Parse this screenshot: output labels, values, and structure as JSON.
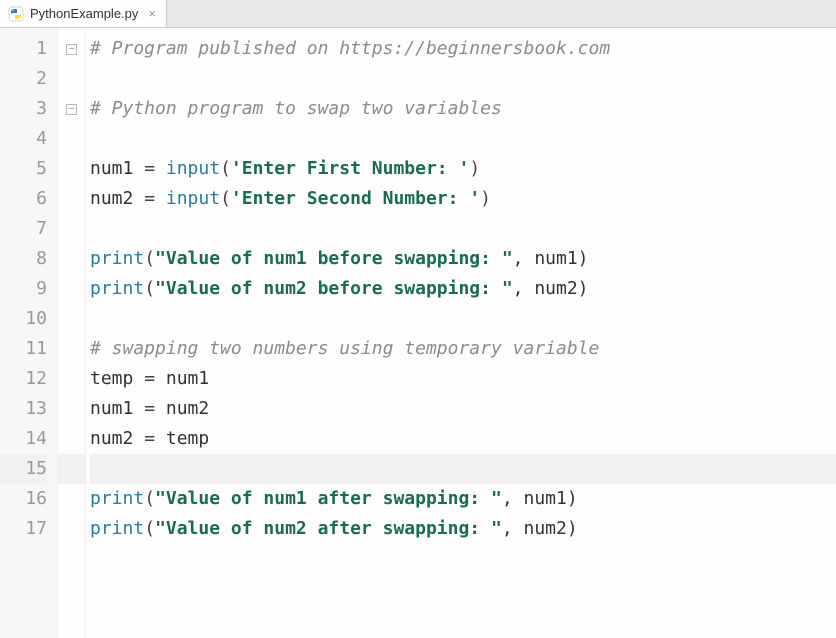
{
  "tab": {
    "filename": "PythonExample.py",
    "close_glyph": "×"
  },
  "lines": [
    {
      "n": 1,
      "fold": "open",
      "tokens": [
        {
          "t": "# Program published on https://beginnersbook.com",
          "c": "cm"
        }
      ]
    },
    {
      "n": 2,
      "tokens": []
    },
    {
      "n": 3,
      "fold": "open",
      "tokens": [
        {
          "t": "# Python program to swap two variables",
          "c": "cm"
        }
      ]
    },
    {
      "n": 4,
      "tokens": []
    },
    {
      "n": 5,
      "tokens": [
        {
          "t": "num1 ",
          "c": "id"
        },
        {
          "t": "= ",
          "c": "op"
        },
        {
          "t": "input",
          "c": "kw"
        },
        {
          "t": "(",
          "c": "op"
        },
        {
          "t": "'Enter First Number: '",
          "c": "str"
        },
        {
          "t": ")",
          "c": "op"
        }
      ]
    },
    {
      "n": 6,
      "tokens": [
        {
          "t": "num2 ",
          "c": "id"
        },
        {
          "t": "= ",
          "c": "op"
        },
        {
          "t": "input",
          "c": "kw"
        },
        {
          "t": "(",
          "c": "op"
        },
        {
          "t": "'Enter Second Number: '",
          "c": "str"
        },
        {
          "t": ")",
          "c": "op"
        }
      ]
    },
    {
      "n": 7,
      "tokens": []
    },
    {
      "n": 8,
      "tokens": [
        {
          "t": "print",
          "c": "kw"
        },
        {
          "t": "(",
          "c": "op"
        },
        {
          "t": "\"Value of num1 before swapping: \"",
          "c": "str"
        },
        {
          "t": ", num1)",
          "c": "id"
        }
      ]
    },
    {
      "n": 9,
      "tokens": [
        {
          "t": "print",
          "c": "kw"
        },
        {
          "t": "(",
          "c": "op"
        },
        {
          "t": "\"Value of num2 before swapping: \"",
          "c": "str"
        },
        {
          "t": ", num2)",
          "c": "id"
        }
      ]
    },
    {
      "n": 10,
      "tokens": []
    },
    {
      "n": 11,
      "tokens": [
        {
          "t": "# swapping two numbers using temporary variable",
          "c": "cm"
        }
      ]
    },
    {
      "n": 12,
      "tokens": [
        {
          "t": "temp ",
          "c": "id"
        },
        {
          "t": "= ",
          "c": "op"
        },
        {
          "t": "num1",
          "c": "id"
        }
      ]
    },
    {
      "n": 13,
      "tokens": [
        {
          "t": "num1 ",
          "c": "id"
        },
        {
          "t": "= ",
          "c": "op"
        },
        {
          "t": "num2",
          "c": "id"
        }
      ]
    },
    {
      "n": 14,
      "tokens": [
        {
          "t": "num2 ",
          "c": "id"
        },
        {
          "t": "= ",
          "c": "op"
        },
        {
          "t": "temp",
          "c": "id"
        }
      ]
    },
    {
      "n": 15,
      "current": true,
      "tokens": []
    },
    {
      "n": 16,
      "tokens": [
        {
          "t": "print",
          "c": "kw"
        },
        {
          "t": "(",
          "c": "op"
        },
        {
          "t": "\"Value of num1 after swapping: \"",
          "c": "str"
        },
        {
          "t": ", num1)",
          "c": "id"
        }
      ]
    },
    {
      "n": 17,
      "tokens": [
        {
          "t": "print",
          "c": "kw"
        },
        {
          "t": "(",
          "c": "op"
        },
        {
          "t": "\"Value of num2 after swapping: \"",
          "c": "str"
        },
        {
          "t": ", num2)",
          "c": "id"
        }
      ]
    }
  ]
}
